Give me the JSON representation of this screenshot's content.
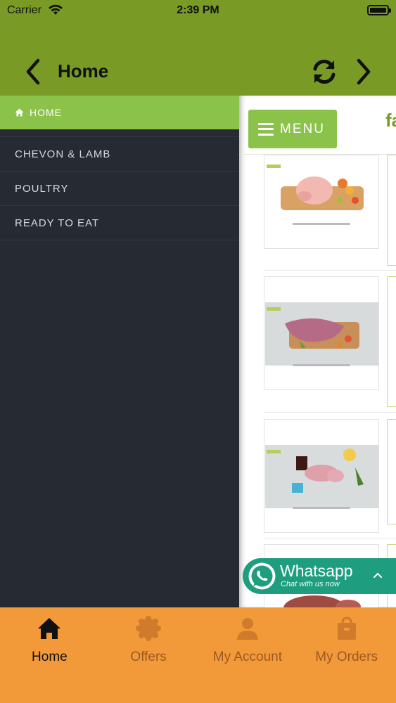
{
  "status_bar": {
    "carrier": "Carrier",
    "time": "2:39 PM"
  },
  "nav": {
    "title": "Home"
  },
  "drawer": {
    "active_item": "HOME",
    "items": [
      "CHEVON & LAMB",
      "POULTRY",
      "READY TO EAT"
    ]
  },
  "content": {
    "menu_label": "MENU",
    "brand_fragment": "fa"
  },
  "whatsapp": {
    "title": "Whatsapp",
    "subtitle": "Chat with us now"
  },
  "tabs": [
    {
      "label": "Home",
      "icon": "home-icon",
      "active": true
    },
    {
      "label": "Offers",
      "icon": "badge-icon",
      "active": false
    },
    {
      "label": "My Account",
      "icon": "person-icon",
      "active": false
    },
    {
      "label": "My Orders",
      "icon": "bag-icon",
      "active": false
    }
  ],
  "colors": {
    "header": "#7a9a26",
    "drawer": "#262a33",
    "accent": "#8bc24a",
    "tabbar": "#f2993a",
    "whatsapp": "#1f9e7f"
  }
}
